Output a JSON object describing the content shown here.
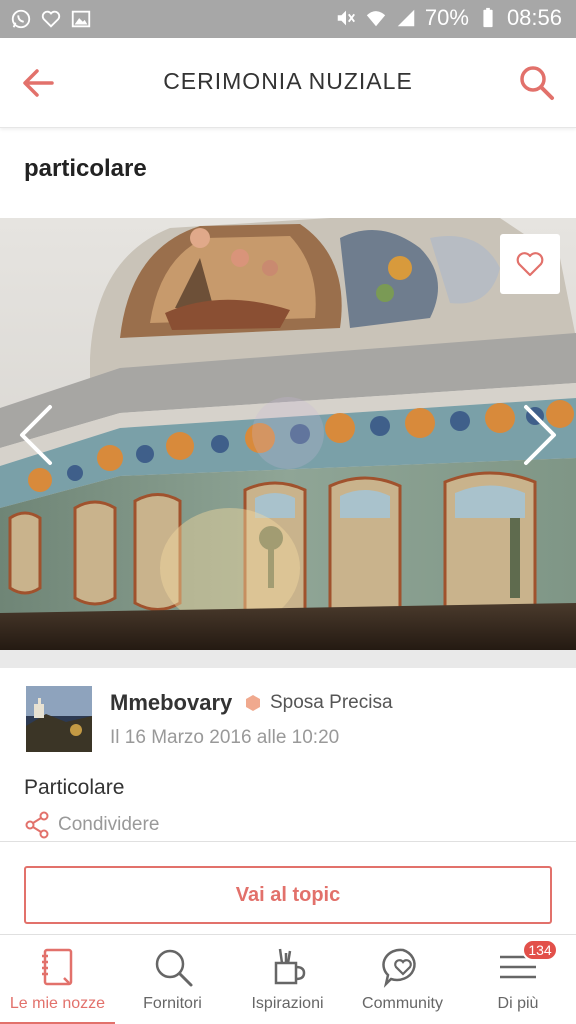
{
  "status_bar": {
    "battery": "70%",
    "time": "08:56",
    "left_icons": [
      "whatsapp-icon",
      "heart-outline-icon",
      "image-icon"
    ],
    "right_icons": [
      "mute-icon",
      "wifi-icon",
      "signal-icon",
      "battery-icon"
    ]
  },
  "header": {
    "title": "CERIMONIA NUZIALE",
    "back_icon": "arrow-left-icon",
    "search_icon": "search-icon",
    "accent": "#e2716b"
  },
  "post": {
    "title": "particolare",
    "author": "Mmebovary",
    "badge": "Sposa Precisa",
    "date": "Il 16 Marzo 2016 alle 10:20",
    "body": "Particolare",
    "share_label": "Condividere"
  },
  "actions": {
    "topic_button": "Vai al topic"
  },
  "bottom_nav": {
    "items": [
      {
        "label": "Le mie nozze",
        "icon": "notebook-icon",
        "active": true
      },
      {
        "label": "Fornitori",
        "icon": "search-icon",
        "active": false
      },
      {
        "label": "Ispirazioni",
        "icon": "brush-cup-icon",
        "active": false
      },
      {
        "label": "Community",
        "icon": "heart-chat-icon",
        "active": false
      },
      {
        "label": "Di più",
        "icon": "menu-icon",
        "active": false
      }
    ],
    "more_badge": "134"
  }
}
